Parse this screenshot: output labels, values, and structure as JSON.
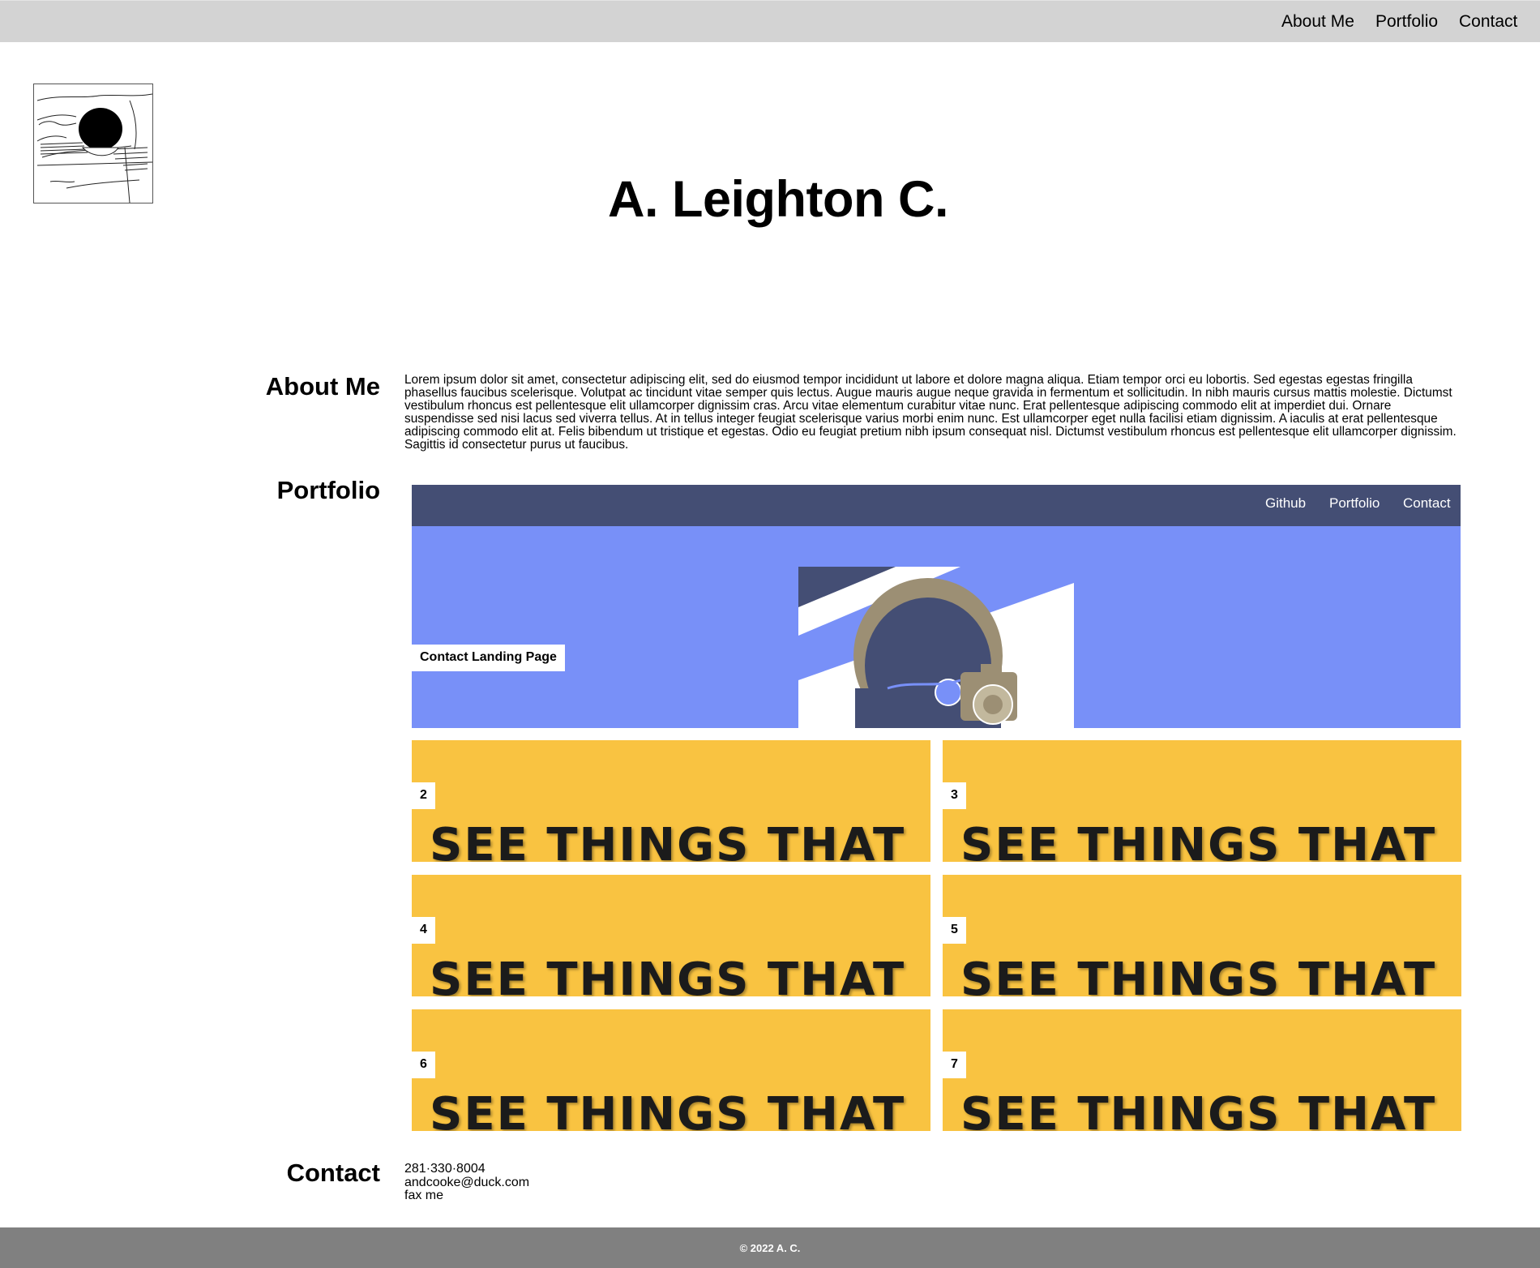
{
  "nav": {
    "items": [
      "About Me",
      "Portfolio",
      "Contact"
    ]
  },
  "site_title": "A. Leighton C.",
  "about": {
    "heading": "About Me",
    "text": "Lorem ipsum dolor sit amet, consectetur adipiscing elit, sed do eiusmod tempor incididunt ut labore et dolore magna aliqua. Etiam tempor orci eu lobortis. Sed egestas egestas fringilla phasellus faucibus scelerisque. Volutpat ac tincidunt vitae semper quis lectus. Augue mauris augue neque gravida in fermentum et sollicitudin. In nibh mauris cursus mattis molestie. Dictumst vestibulum rhoncus est pellentesque elit ullamcorper dignissim cras. Arcu vitae elementum curabitur vitae nunc. Erat pellentesque adipiscing commodo elit at imperdiet dui. Ornare suspendisse sed nisi lacus sed viverra tellus. At in tellus integer feugiat scelerisque varius morbi enim nunc. Est ullamcorper eget nulla facilisi etiam dignissim. A iaculis at erat pellentesque adipiscing commodo elit at. Felis bibendum ut tristique et egestas. Odio eu feugiat pretium nibh ipsum consequat nisl. Dictumst vestibulum rhoncus est pellentesque elit ullamcorper dignissim. Sagittis id consectetur purus ut faucibus."
  },
  "portfolio": {
    "heading": "Portfolio",
    "featured": {
      "nav": [
        "Github",
        "Portfolio",
        "Contact"
      ],
      "label": "Contact Landing Page"
    },
    "tiles": [
      {
        "label": "2",
        "image_text": "SEE THINGS THAT"
      },
      {
        "label": "3",
        "image_text": "SEE THINGS THAT"
      },
      {
        "label": "4",
        "image_text": "SEE THINGS THAT"
      },
      {
        "label": "5",
        "image_text": "SEE THINGS THAT"
      },
      {
        "label": "6",
        "image_text": "SEE THINGS THAT"
      },
      {
        "label": "7",
        "image_text": "SEE THINGS THAT"
      }
    ]
  },
  "contact": {
    "heading": "Contact",
    "phone": "281·330·8004",
    "email": "andcooke@duck.com",
    "fax": "fax me"
  },
  "footer": {
    "text": "© 2022 A. C."
  },
  "colors": {
    "nav_bg": "#d3d3d3",
    "featured_nav_bg": "#444e74",
    "featured_bg": "#7890f8",
    "tile_bg": "#f9c341",
    "footer_bg": "#808080"
  }
}
